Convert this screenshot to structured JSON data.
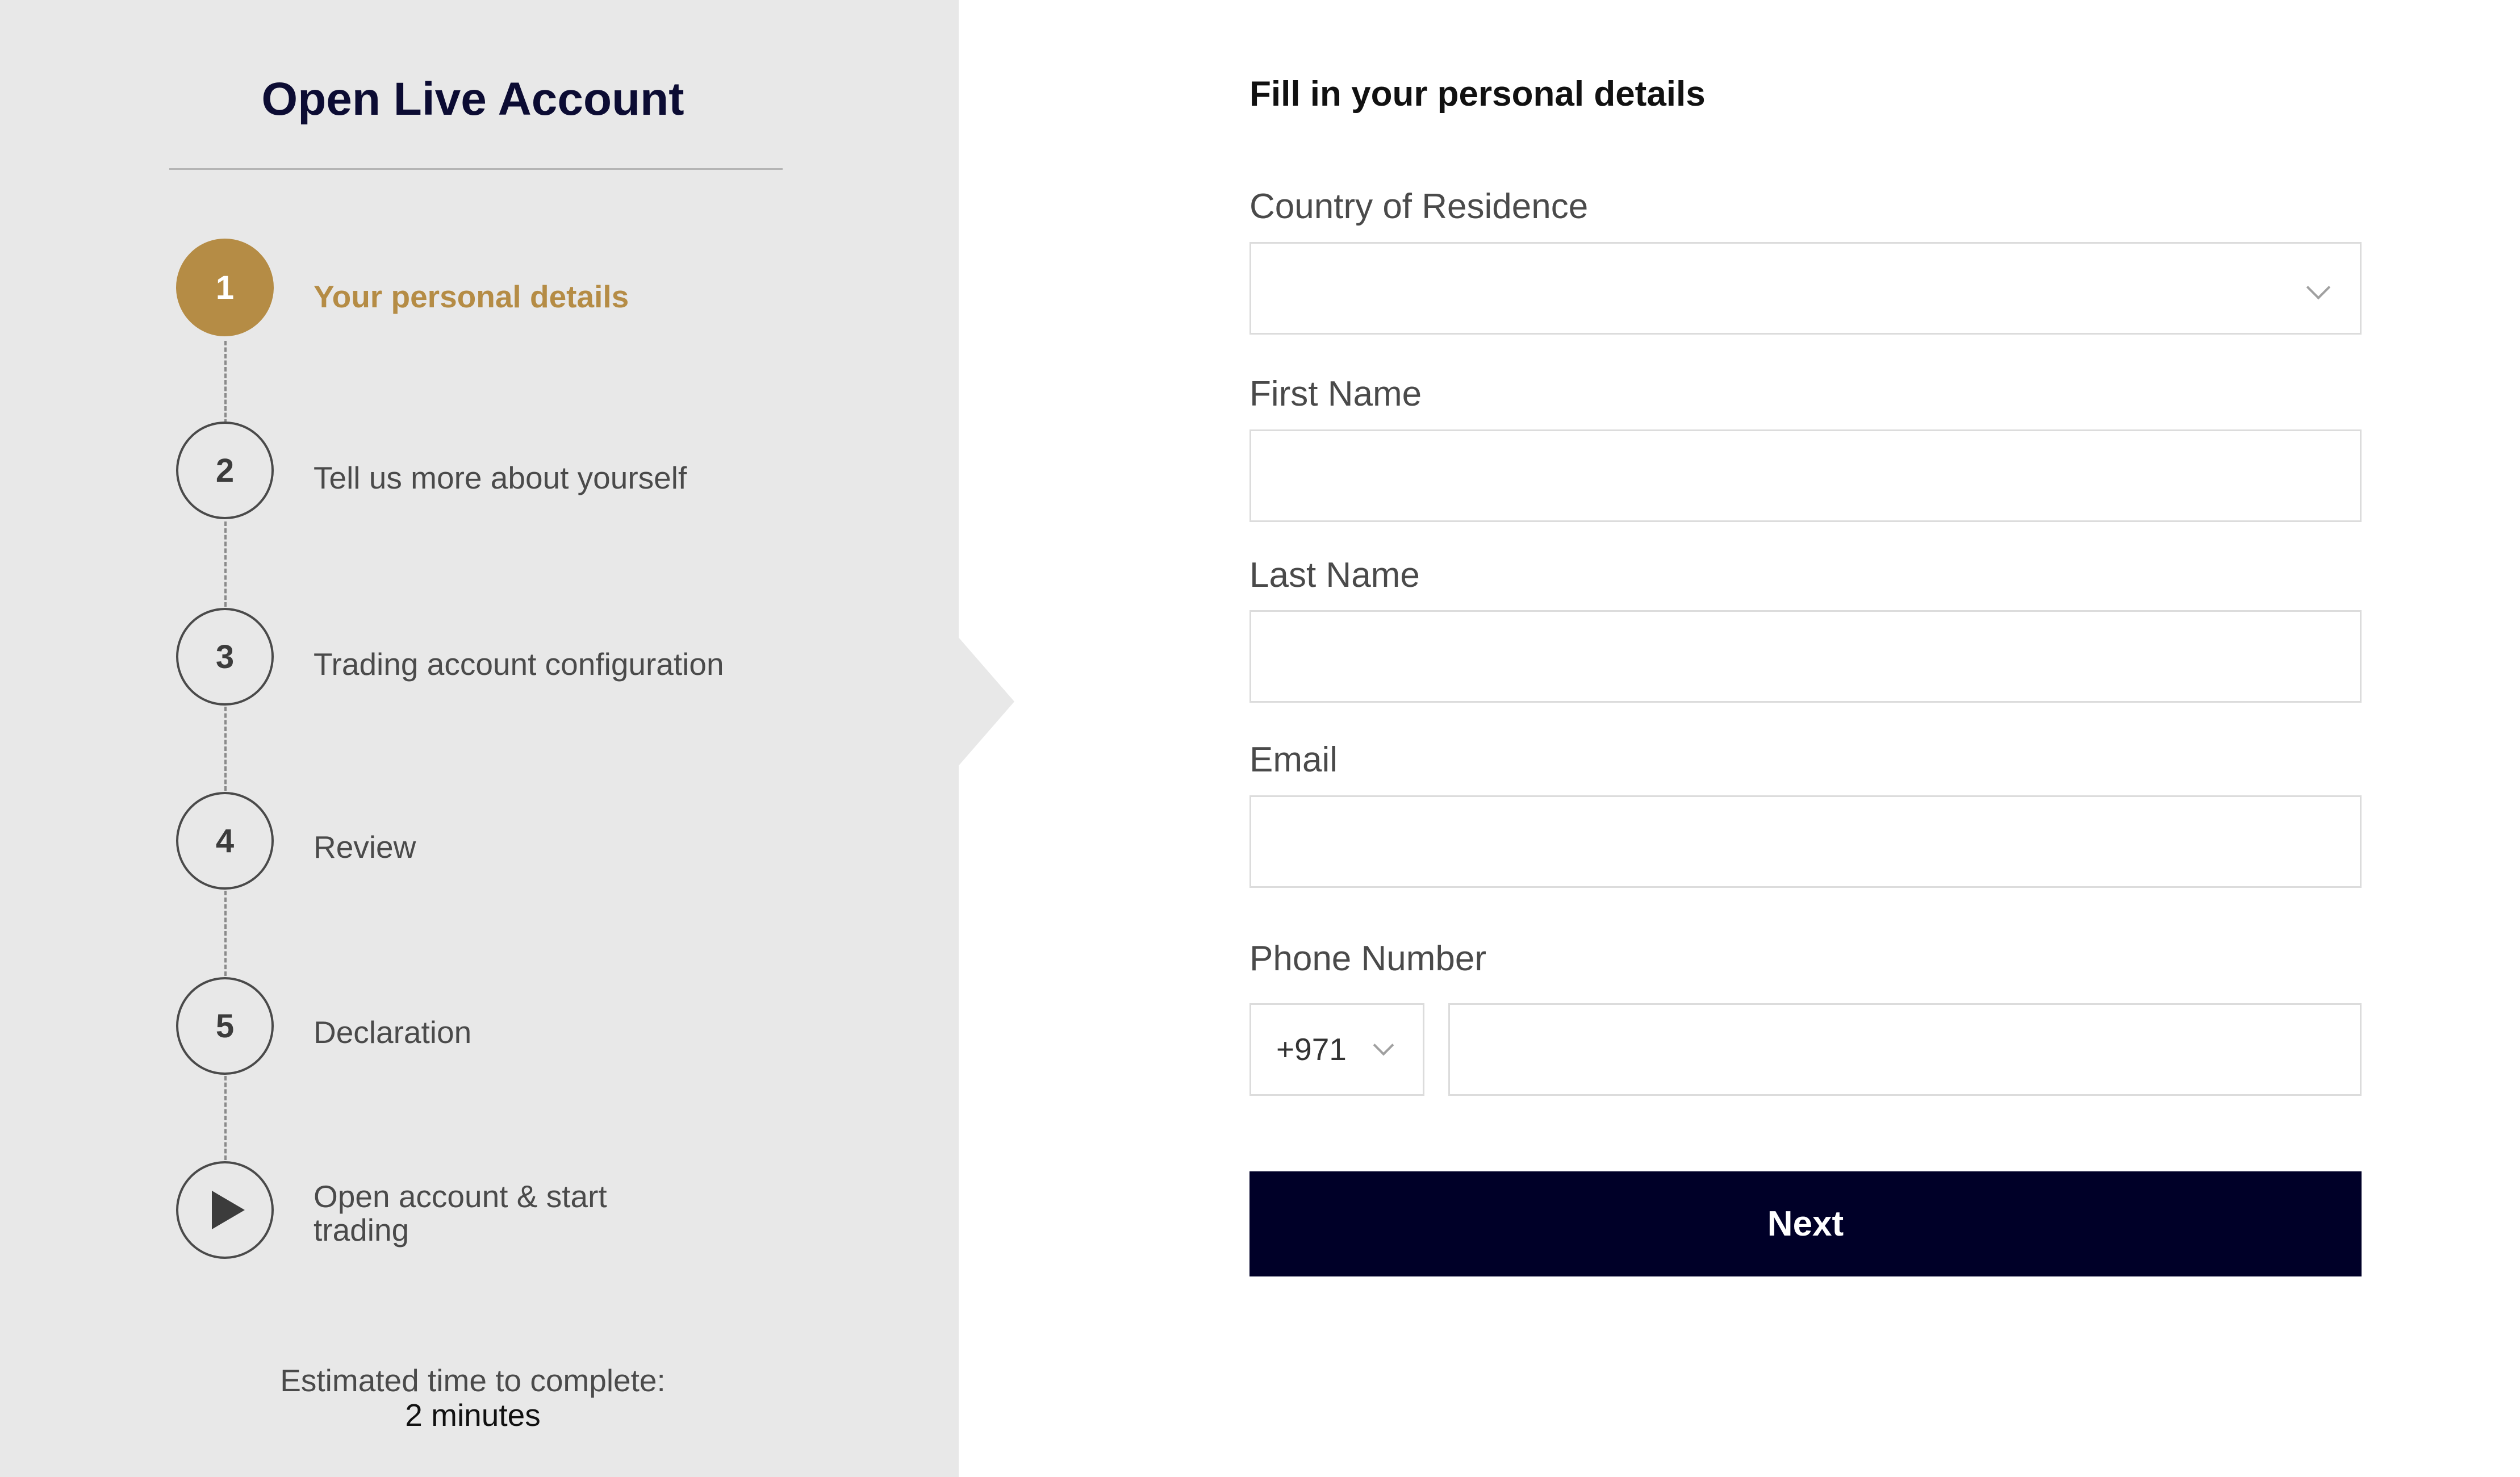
{
  "sidebar": {
    "title": "Open Live Account",
    "steps": [
      {
        "number": "1",
        "label": "Your personal details",
        "active": true
      },
      {
        "number": "2",
        "label": "Tell us more about yourself"
      },
      {
        "number": "3",
        "label": "Trading account configuration"
      },
      {
        "number": "4",
        "label": "Review"
      },
      {
        "number": "5",
        "label": "Declaration"
      },
      {
        "number": "",
        "label": "Open account & start trading",
        "icon": "play-icon"
      }
    ],
    "estimate_label": "Estimated time to complete:",
    "estimate_value": "2 minutes"
  },
  "form": {
    "heading": "Fill in your personal details",
    "country_label": "Country of Residence",
    "country_value": "",
    "first_name_label": "First Name",
    "first_name_value": "",
    "last_name_label": "Last Name",
    "last_name_value": "",
    "email_label": "Email",
    "email_value": "",
    "phone_label": "Phone Number",
    "phone_code": "+971",
    "phone_value": "",
    "next_label": "Next"
  },
  "colors": {
    "accent_gold": "#b58c45",
    "navy_button": "#000028",
    "sidebar_bg": "#e8e8e8"
  }
}
